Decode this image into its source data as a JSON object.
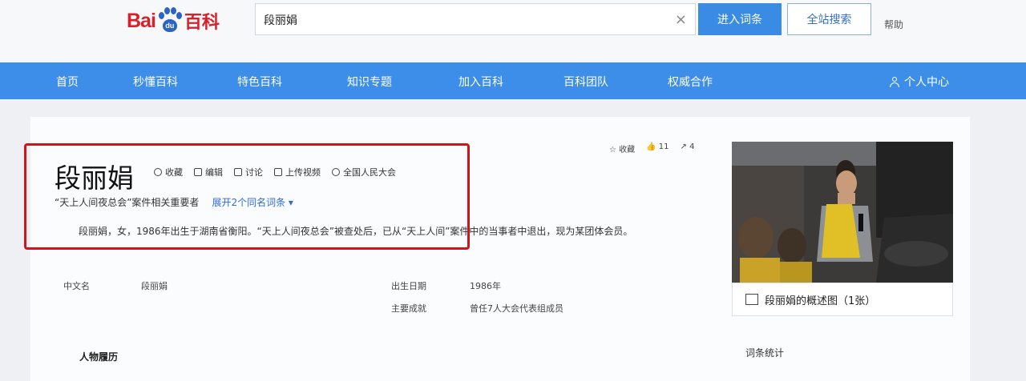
{
  "header": {
    "logo_bai": "Bai",
    "logo_du": "du",
    "logo_baike": "百科",
    "search_value": "段丽娟",
    "clear": "×",
    "enter_button": "进入词条",
    "search_button": "全站搜索",
    "help": "帮助"
  },
  "nav": {
    "items": [
      "首页",
      "秒懂百科",
      "特色百科",
      "知识专题",
      "加入百科",
      "百科团队",
      "权威合作"
    ],
    "user": "个人中心"
  },
  "entry": {
    "title": "段丽娟",
    "tools": [
      "收藏",
      "编辑",
      "讨论",
      "上传视频",
      "全国人民大会"
    ],
    "stats": [
      "收藏",
      "11",
      "4"
    ],
    "subtitle": "“天上人间夜总会”案件相关重要者",
    "subtitle_link": "展开2个同名词条 ▾",
    "description": "段丽娟，女，1986年出生于湖南省衡阳。“天上人间夜总会”被查处后，已从“天上人间”案件中的当事者中退出，现为某团体会员。",
    "album": "段丽娟的概述图（1张）"
  },
  "info": {
    "name_label": "中文名",
    "name_value": "段丽娟",
    "birth_label": "出生日期",
    "birth_value": "1986年",
    "works_label": "主要成就",
    "works_value": "曾任7人大会代表组成员"
  },
  "sections": {
    "person": "人物履历",
    "stats": "词条统计"
  },
  "colors": {
    "brand_red": "#d6202a",
    "brand_blue": "#2d63c8",
    "nav_blue": "#3c8ee8",
    "highlight": "#d0141b"
  }
}
